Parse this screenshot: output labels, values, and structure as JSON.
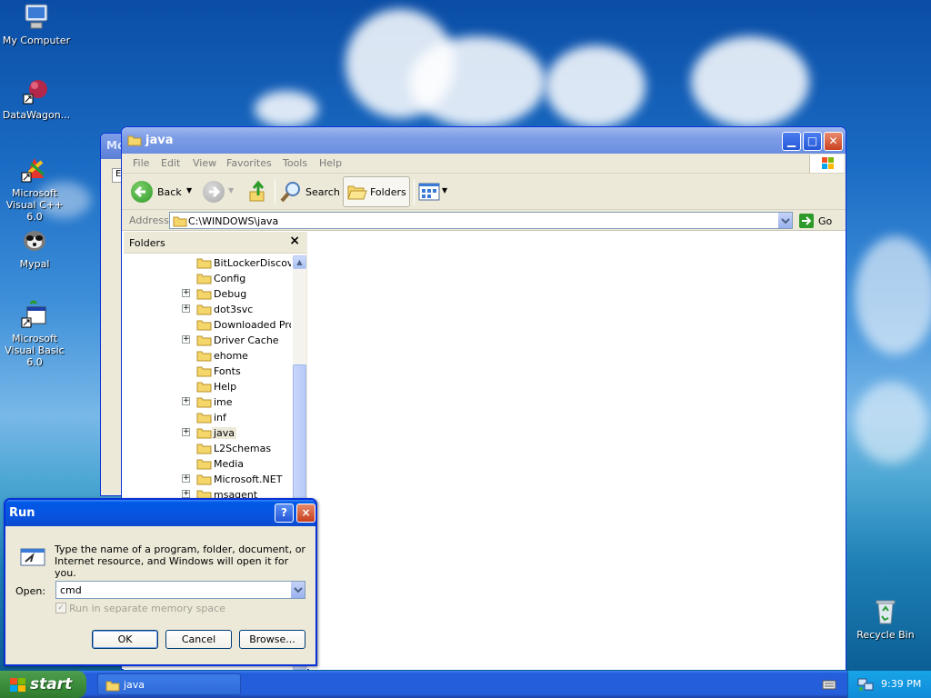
{
  "desktop": {
    "icons": [
      {
        "label": "My Computer",
        "icon": "my-computer-icon"
      },
      {
        "label": "DataWagon...",
        "icon": "datawagon-icon"
      },
      {
        "label": "Microsoft Visual C++ 6.0",
        "icon": "visual-cpp-icon"
      },
      {
        "label": "Mypal",
        "icon": "mypal-icon"
      },
      {
        "label": "Microsoft Visual Basic 6.0",
        "icon": "visual-basic-icon"
      },
      {
        "label": "Recycle Bin",
        "icon": "recycle-bin-icon"
      }
    ]
  },
  "back_window": {
    "title": "Mo",
    "tab": "E"
  },
  "explorer": {
    "title": "java",
    "menu": [
      "File",
      "Edit",
      "View",
      "Favorites",
      "Tools",
      "Help"
    ],
    "toolbar": {
      "back": "Back",
      "search": "Search",
      "folders": "Folders"
    },
    "address": {
      "label": "Address",
      "value": "C:\\WINDOWS\\java",
      "go": "Go"
    },
    "folders_pane": {
      "title": "Folders",
      "close": "×",
      "items": [
        {
          "label": "BitLockerDiscover",
          "expandable": false,
          "selected": false
        },
        {
          "label": "Config",
          "expandable": false,
          "selected": false
        },
        {
          "label": "Debug",
          "expandable": true,
          "selected": false
        },
        {
          "label": "dot3svc",
          "expandable": true,
          "selected": false
        },
        {
          "label": "Downloaded Prog",
          "expandable": false,
          "selected": false
        },
        {
          "label": "Driver Cache",
          "expandable": true,
          "selected": false
        },
        {
          "label": "ehome",
          "expandable": false,
          "selected": false
        },
        {
          "label": "Fonts",
          "expandable": false,
          "selected": false
        },
        {
          "label": "Help",
          "expandable": false,
          "selected": false
        },
        {
          "label": "ime",
          "expandable": true,
          "selected": false
        },
        {
          "label": "inf",
          "expandable": false,
          "selected": false
        },
        {
          "label": "java",
          "expandable": true,
          "selected": true
        },
        {
          "label": "L2Schemas",
          "expandable": false,
          "selected": false
        },
        {
          "label": "Media",
          "expandable": false,
          "selected": false
        },
        {
          "label": "Microsoft.NET",
          "expandable": true,
          "selected": false
        },
        {
          "label": "msagent",
          "expandable": true,
          "selected": false
        }
      ]
    }
  },
  "run_dialog": {
    "title": "Run",
    "help": "?",
    "close": "×",
    "description": "Type the name of a program, folder, document, or Internet resource, and Windows will open it for you.",
    "open_label": "Open:",
    "open_value": "cmd",
    "checkbox_label": "Run in separate memory space",
    "ok": "OK",
    "cancel": "Cancel",
    "browse": "Browse..."
  },
  "taskbar": {
    "start": "start",
    "task": "java",
    "clock": "9:39 PM"
  }
}
